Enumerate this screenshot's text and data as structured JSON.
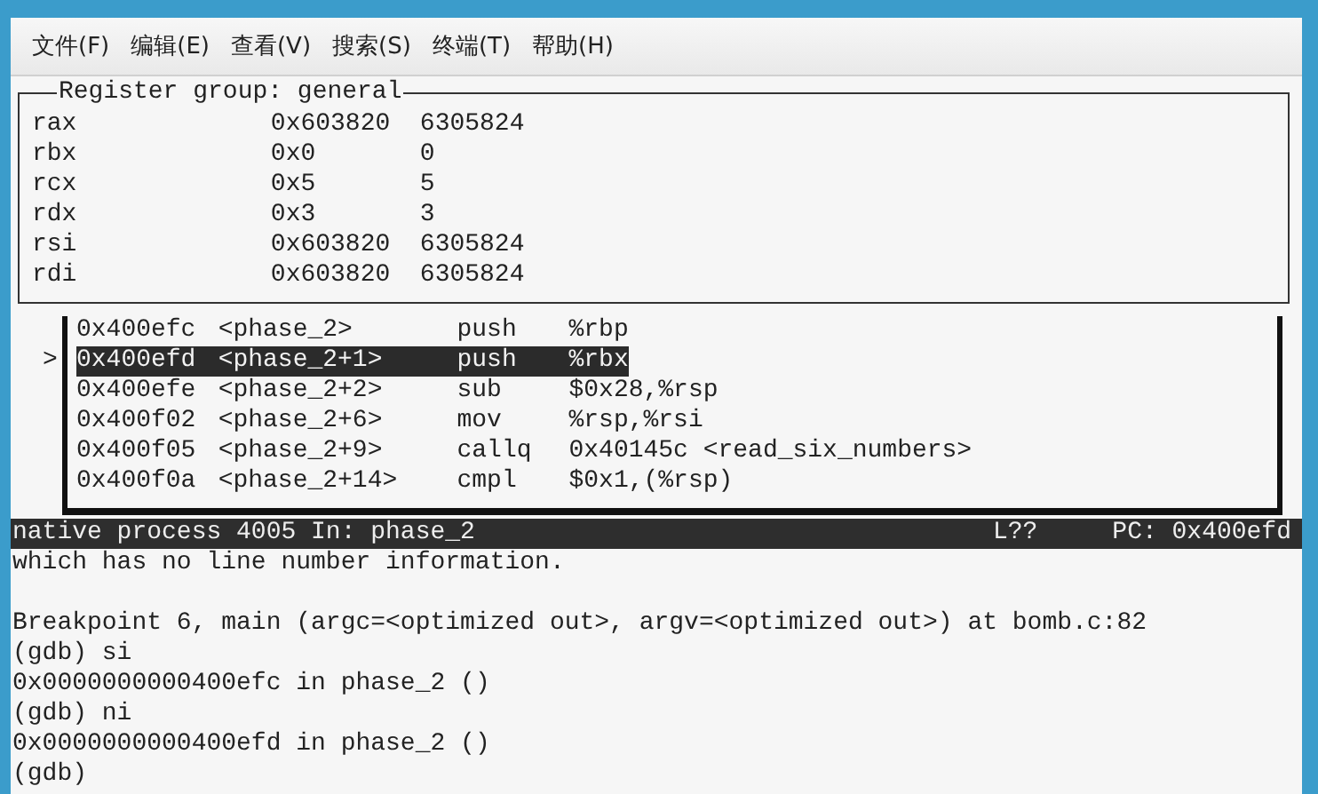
{
  "menu": [
    "文件(F)",
    "编辑(E)",
    "查看(V)",
    "搜索(S)",
    "终端(T)",
    "帮助(H)"
  ],
  "registers": {
    "title": "Register group: general",
    "rows": [
      {
        "name": "rax",
        "hex": "0x603820",
        "value": "6305824"
      },
      {
        "name": "rbx",
        "hex": "0x0",
        "value": "0"
      },
      {
        "name": "rcx",
        "hex": "0x5",
        "value": "5"
      },
      {
        "name": "rdx",
        "hex": "0x3",
        "value": "3"
      },
      {
        "name": "rsi",
        "hex": "0x603820",
        "value": "6305824"
      },
      {
        "name": "rdi",
        "hex": "0x603820",
        "value": "6305824"
      }
    ]
  },
  "disassembly": {
    "pointer": ">",
    "rows": [
      {
        "address": "0x400efc",
        "symbol": "<phase_2>",
        "mnemonic": "push",
        "operands": "%rbp",
        "selected": false
      },
      {
        "address": "0x400efd",
        "symbol": "<phase_2+1>",
        "mnemonic": "push",
        "operands": "%rbx",
        "selected": true
      },
      {
        "address": "0x400efe",
        "symbol": "<phase_2+2>",
        "mnemonic": "sub",
        "operands": "$0x28,%rsp",
        "selected": false
      },
      {
        "address": "0x400f02",
        "symbol": "<phase_2+6>",
        "mnemonic": "mov",
        "operands": "%rsp,%rsi",
        "selected": false
      },
      {
        "address": "0x400f05",
        "symbol": "<phase_2+9>",
        "mnemonic": "callq",
        "operands": "0x40145c <read_six_numbers>",
        "selected": false
      },
      {
        "address": "0x400f0a",
        "symbol": "<phase_2+14>",
        "mnemonic": "cmpl",
        "operands": "$0x1,(%rsp)",
        "selected": false
      }
    ]
  },
  "status_bar": {
    "process": "native process 4005 In: phase_2",
    "line": "L??",
    "pc": "PC: 0x400efd"
  },
  "console_blocks": [
    [
      "which has no line number information."
    ],
    [
      "Breakpoint 6, main (argc=<optimized out>, argv=<optimized out>) at bomb.c:82",
      "(gdb) si",
      "0x0000000000400efc in phase_2 ()",
      "(gdb) ni",
      "0x0000000000400efd in phase_2 ()",
      "(gdb)"
    ]
  ]
}
